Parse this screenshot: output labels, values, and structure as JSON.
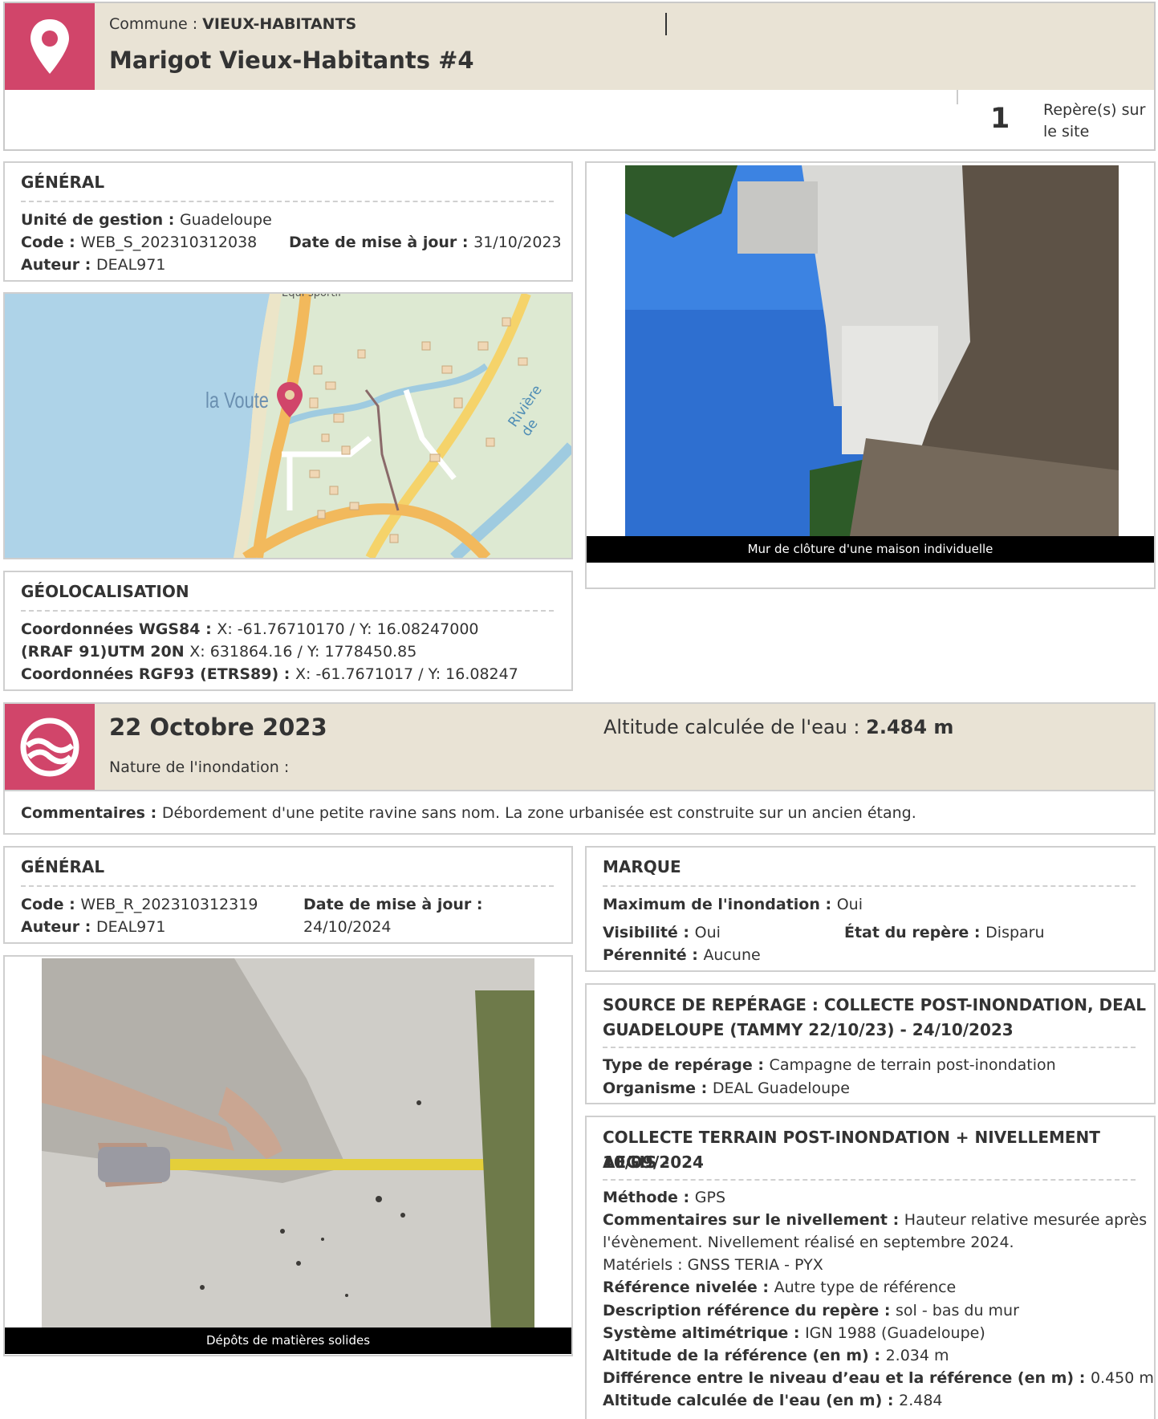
{
  "site": {
    "commune_label": "Commune : ",
    "commune_value": "VIEUX-HABITANTS",
    "title": "Marigot Vieux-Habitants #4",
    "reperes_count": "1",
    "reperes_label_1": "Repère(s) sur",
    "reperes_label_2": "le site"
  },
  "general_site": {
    "heading": "GÉNÉRAL",
    "unite_label": "Unité de gestion : ",
    "unite_value": "Guadeloupe",
    "code_label": "Code : ",
    "code_value": "WEB_S_202310312038",
    "date_label": "Date de mise à jour : ",
    "date_value": "31/10/2023",
    "auteur_label": "Auteur : ",
    "auteur_value": "DEAL971"
  },
  "map": {
    "place_label": "la Voute",
    "top_label": "Equi-sportif",
    "river_label": "Rivière de",
    "accent": "#d1456a",
    "sea_color": "#aed3e8",
    "land_color": "#dde9d2",
    "road_color": "#f2b95c"
  },
  "photo_site": {
    "caption": "Mur de clôture d'une maison individuelle"
  },
  "geo": {
    "heading": "GÉOLOCALISATION",
    "wgs_label": "Coordonnées WGS84 : ",
    "wgs_value": "X: -61.76710170 / Y: 16.08247000",
    "utm_label": "(RRAF 91)UTM 20N ",
    "utm_value": "X: 631864.16 / Y: 1778450.85",
    "rgf_label": "Coordonnées RGF93 (ETRS89) : ",
    "rgf_value": "X: -61.7671017 / Y: 16.08247"
  },
  "event": {
    "date": "22 Octobre 2023",
    "altitude_label": "Altitude calculée de l'eau : ",
    "altitude_value": "2.484 m",
    "nature_label": "Nature de l'inondation :",
    "comment_label": "Commentaires : ",
    "comment_value": "Débordement d'une petite ravine sans nom. La zone urbanisée est construite sur un ancien étang."
  },
  "general_repere": {
    "heading": "GÉNÉRAL",
    "code_label": "Code : ",
    "code_value": "WEB_R_202310312319",
    "date_label": "Date de mise à jour :",
    "date_value": "24/10/2024",
    "auteur_label": "Auteur : ",
    "auteur_value": "DEAL971"
  },
  "photo_repere": {
    "caption": "Dépôts de matières solides"
  },
  "marque": {
    "heading": "MARQUE",
    "max_label": "Maximum de l'inondation : ",
    "max_value": "Oui",
    "vis_label": "Visibilité : ",
    "vis_value": "Oui",
    "etat_label": "État du repère : ",
    "etat_value": "Disparu",
    "per_label": "Pérennité : ",
    "per_value": "Aucune"
  },
  "source": {
    "heading_1": "SOURCE DE REPÉRAGE : COLLECTE POST-INONDATION, DEAL",
    "heading_2": "GUADELOUPE (TAMMY 22/10/23) - 24/10/2023",
    "type_label": "Type de repérage : ",
    "type_value": "Campagne de terrain post-inondation",
    "org_label": "Organisme : ",
    "org_value": "DEAL Guadeloupe"
  },
  "collecte": {
    "heading_1": "COLLECTE TERRAIN POST-INONDATION + NIVELLEMENT AEGIS -",
    "heading_2": "10/09/2024",
    "methode_label": "Méthode : ",
    "methode_value": "GPS",
    "comm_label": "Commentaires sur le nivellement : ",
    "comm_value_1": "Hauteur relative mesurée après",
    "comm_value_2": "l'évènement. Nivellement réalisé en septembre 2024.",
    "materiels": "Matériels : GNSS TERIA - PYX",
    "ref_label": "Référence nivelée : ",
    "ref_value": "Autre type de référence",
    "desc_label": "Description référence du repère : ",
    "desc_value": "sol - bas du mur",
    "sys_label": "Système altimétrique : ",
    "sys_value": "IGN 1988 (Guadeloupe)",
    "alt_ref_label": "Altitude de la référence (en m) : ",
    "alt_ref_value": "2.034 m",
    "diff_label": "Différence entre le niveau d’eau et la référence (en m) : ",
    "diff_value": "0.450 m",
    "alt_eau_label": "Altitude calculée de l'eau (en m) : ",
    "alt_eau_value": "2.484"
  }
}
